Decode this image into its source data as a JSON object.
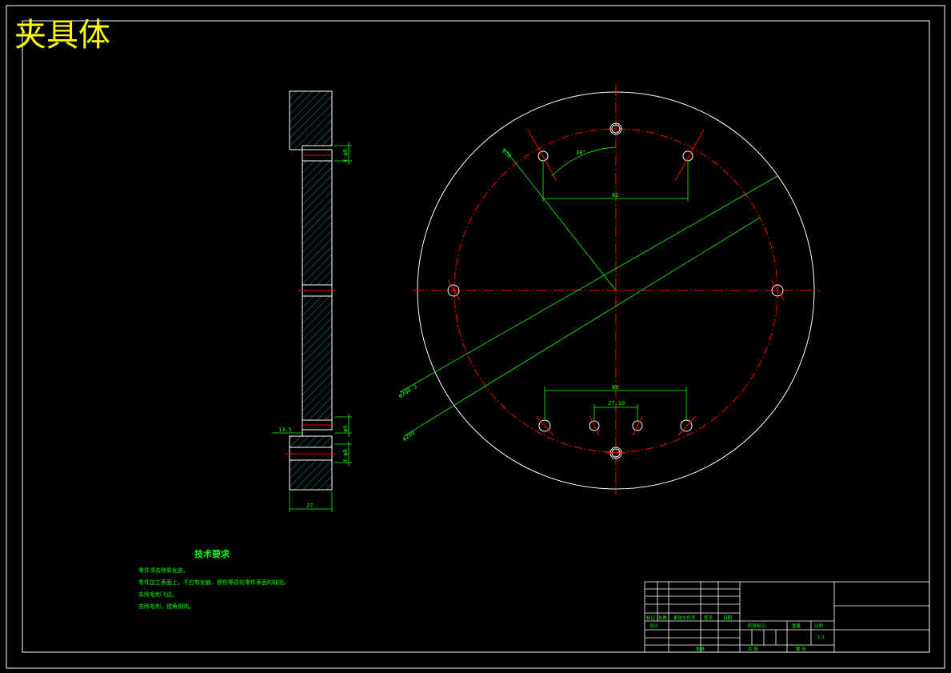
{
  "drawing": {
    "title": "夹具体"
  },
  "side_view": {
    "dims": {
      "width_bottom": "27",
      "offset_left": "13.5",
      "hole_top": "4-φ8",
      "hole_bottom": "φ8.5",
      "small_a": "φ6",
      "small_b": "4-φ8"
    }
  },
  "plan_view": {
    "dims": {
      "angle": "30°",
      "chord_top": "82",
      "chord_bottom": "80",
      "chord_inner": "27.10",
      "radial_small": "φ10",
      "dia_outer": "φ200.3",
      "dia_bolt": "φ200"
    }
  },
  "tech_notes": {
    "heading": "技术要求",
    "lines": [
      "零件须去除氧化皮。",
      "零件加工表面上，不应有划痕、擦伤等损伤零件表面的缺陷。",
      "去除毛刺飞边。",
      "去除毛刺，锐角倒钝。"
    ]
  },
  "title_block": {
    "labels": {
      "mark": "标记",
      "count": "处数",
      "doc": "更改文件号",
      "sign": "签字",
      "date": "日期",
      "design": "设计",
      "approve": "批准",
      "stage": "阶段标记",
      "weight": "重量",
      "scale": "比例",
      "scale_value": "1:1",
      "sheets_total": "共 张",
      "sheet_no": "第 张"
    }
  }
}
